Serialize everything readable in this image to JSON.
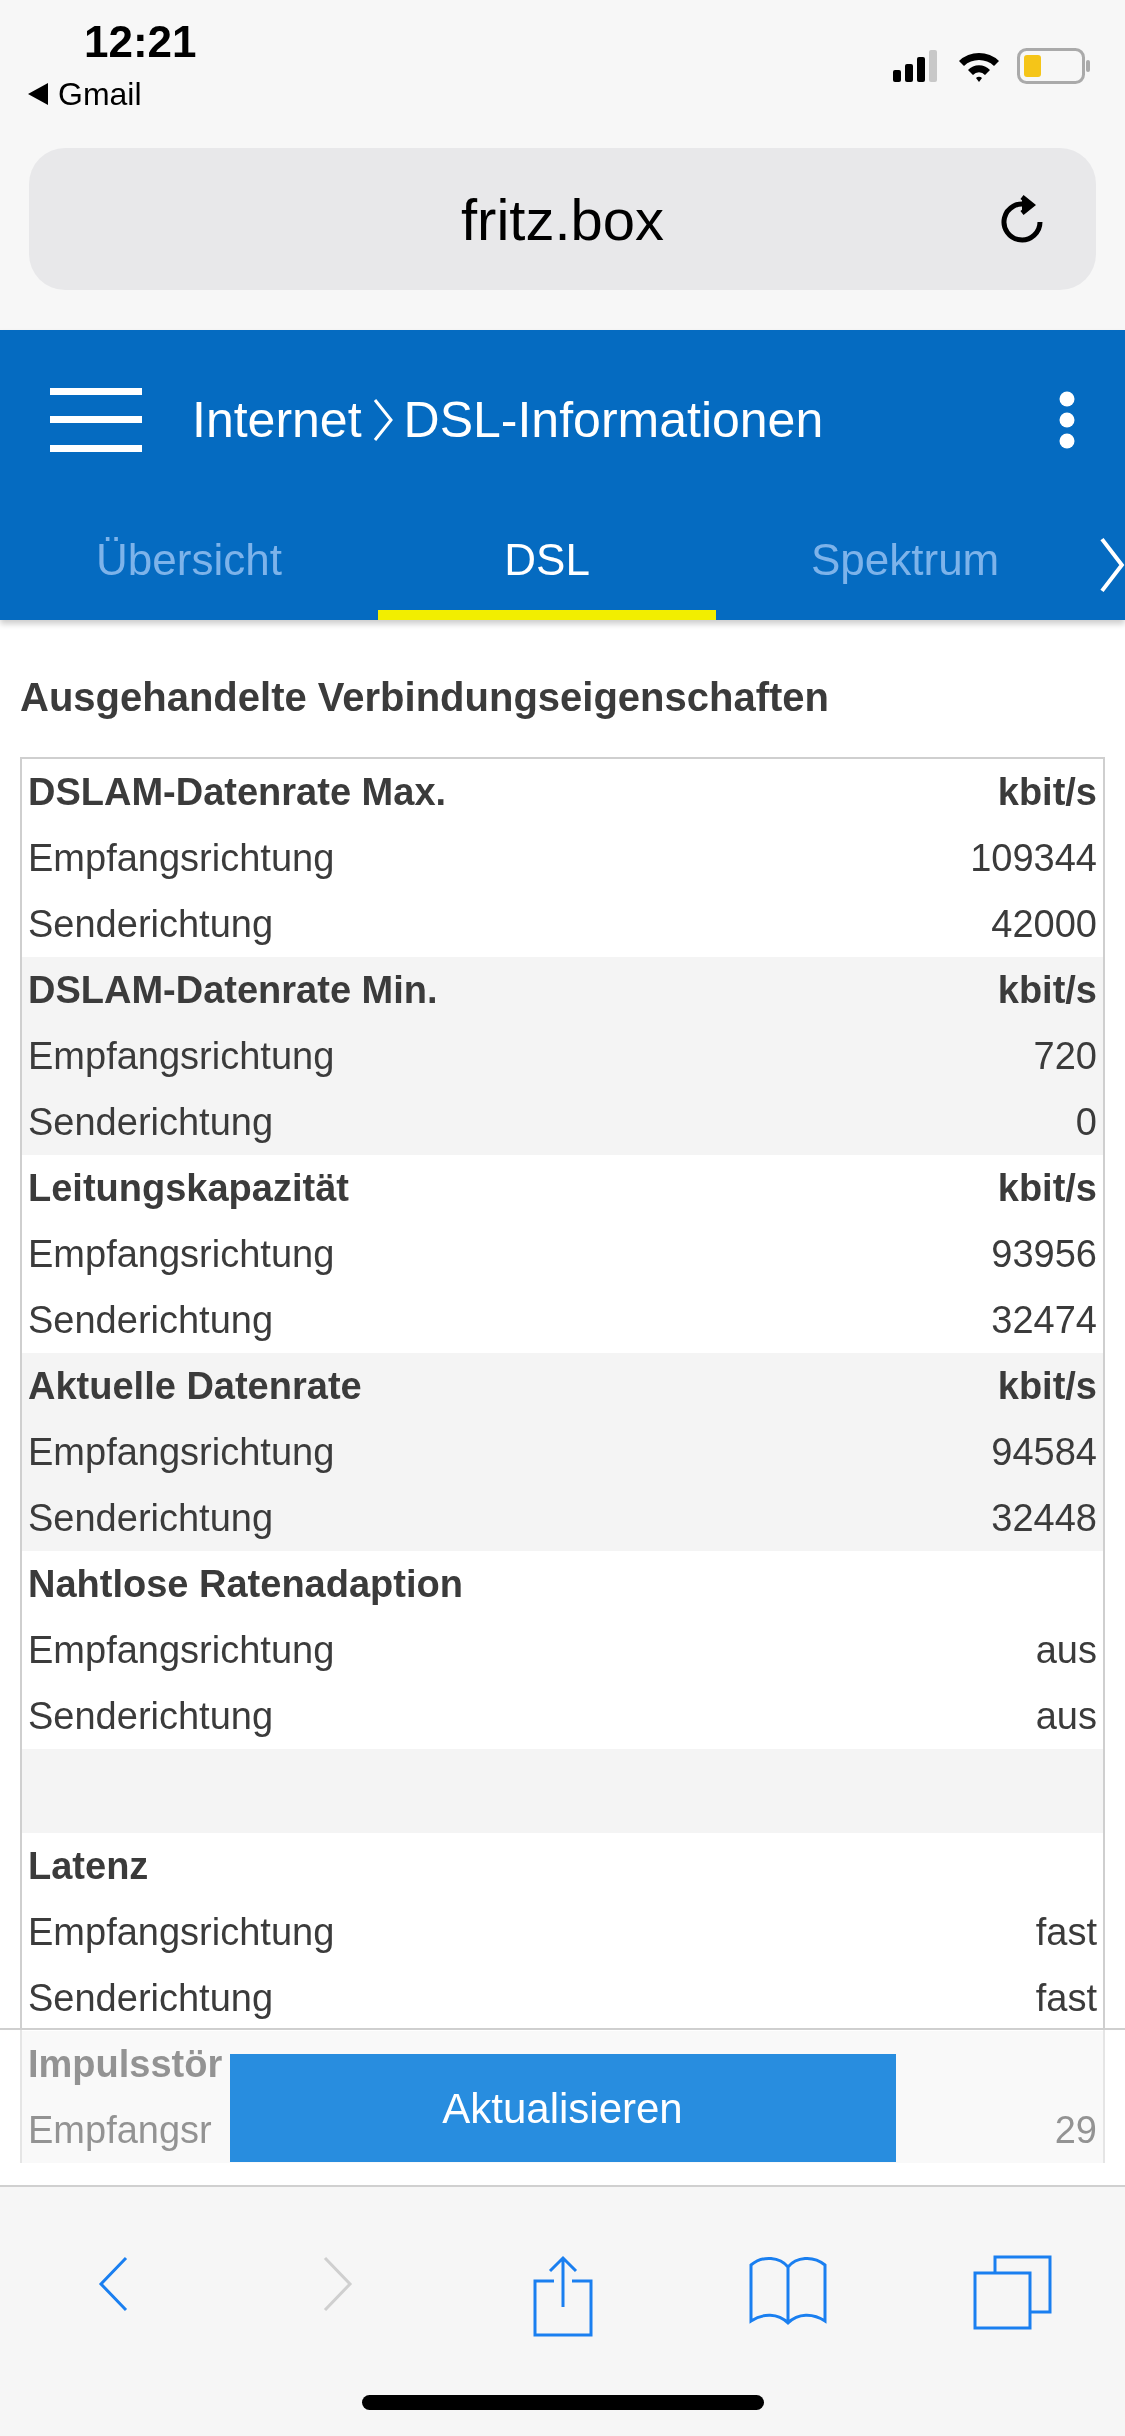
{
  "status_bar": {
    "time": "12:21",
    "back_app": "Gmail"
  },
  "address_bar": {
    "url": "fritz.box"
  },
  "header": {
    "breadcrumb": [
      "Internet",
      "DSL-Informationen"
    ]
  },
  "tabs": [
    {
      "label": "Übersicht",
      "selected": false
    },
    {
      "label": "DSL",
      "selected": true
    },
    {
      "label": "Spektrum",
      "selected": false
    }
  ],
  "section_title": "Ausgehandelte Verbindungseigenschaften",
  "table": [
    {
      "kind": "group",
      "title": "DSLAM-Datenrate Max.",
      "unit": "kbit/s",
      "rows": [
        {
          "label": "Empfangsrichtung",
          "value": "109344"
        },
        {
          "label": "Senderichtung",
          "value": "42000"
        }
      ]
    },
    {
      "kind": "group",
      "title": "DSLAM-Datenrate Min.",
      "unit": "kbit/s",
      "rows": [
        {
          "label": "Empfangsrichtung",
          "value": "720"
        },
        {
          "label": "Senderichtung",
          "value": "0"
        }
      ]
    },
    {
      "kind": "group",
      "title": "Leitungskapazität",
      "unit": "kbit/s",
      "rows": [
        {
          "label": "Empfangsrichtung",
          "value": "93956"
        },
        {
          "label": "Senderichtung",
          "value": "32474"
        }
      ]
    },
    {
      "kind": "group",
      "title": "Aktuelle Datenrate",
      "unit": "kbit/s",
      "rows": [
        {
          "label": "Empfangsrichtung",
          "value": "94584"
        },
        {
          "label": "Senderichtung",
          "value": "32448"
        }
      ]
    },
    {
      "kind": "group",
      "title": "Nahtlose Ratenadaption",
      "rows": [
        {
          "label": "Empfangsrichtung",
          "value": "aus"
        },
        {
          "label": "Senderichtung",
          "value": "aus"
        }
      ]
    },
    {
      "kind": "spacer"
    },
    {
      "kind": "group",
      "title": "Latenz",
      "rows": [
        {
          "label": "Empfangsrichtung",
          "value": "fast"
        },
        {
          "label": "Senderichtung",
          "value": "fast"
        }
      ]
    },
    {
      "kind": "group",
      "title": "Impulsstör",
      "rows": [
        {
          "label": "Empfangsr",
          "value": "29"
        }
      ]
    }
  ],
  "footer": {
    "button": "Aktualisieren"
  },
  "toolbar": [
    {
      "kind": "back",
      "disabled": false
    },
    {
      "kind": "forward",
      "disabled": true
    },
    {
      "kind": "share",
      "disabled": false
    },
    {
      "kind": "bookmarks",
      "disabled": false
    },
    {
      "kind": "tabs",
      "disabled": false
    }
  ]
}
